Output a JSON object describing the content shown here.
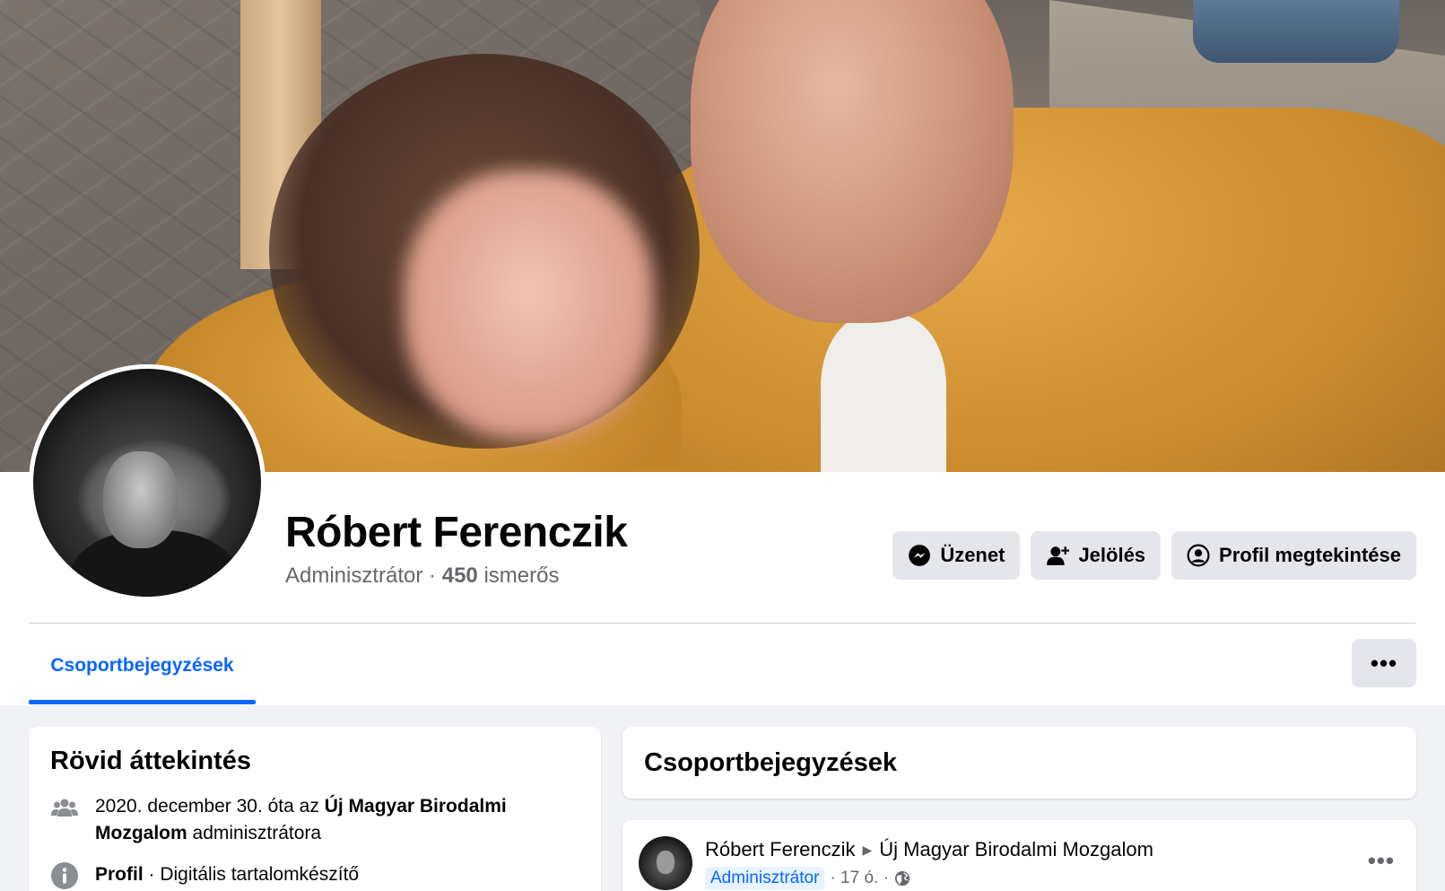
{
  "profile": {
    "name": "Róbert Ferenczik",
    "role": "Adminisztrátor",
    "separator": "·",
    "friends_count": "450",
    "friends_label": "ismerős"
  },
  "actions": {
    "message_label": "Üzenet",
    "mention_label": "Jelölés",
    "view_profile_label": "Profil megtekintése"
  },
  "tabs": {
    "active_label": "Csoportbejegyzések",
    "more_label": "•••"
  },
  "overview": {
    "title": "Rövid áttekintés",
    "admin_since_prefix": "2020. december 30. óta az",
    "group_name": "Új Magyar Birodalmi Mozgalom",
    "admin_since_suffix": "adminisztrátora",
    "profile_label": "Profil",
    "profile_detail": "· Digitális tartalomkészítő"
  },
  "posts": {
    "title": "Csoportbejegyzések",
    "items": [
      {
        "author": "Róbert Ferenczik",
        "group": "Új Magyar Birodalmi Mozgalom",
        "badge": "Adminisztrátor",
        "time": "· 17 ó. ·",
        "more_label": "•••"
      }
    ]
  },
  "colors": {
    "accent": "#0866ff",
    "button_bg": "#e4e6eb",
    "page_bg": "#f0f2f5",
    "secondary_text": "#65676b"
  }
}
